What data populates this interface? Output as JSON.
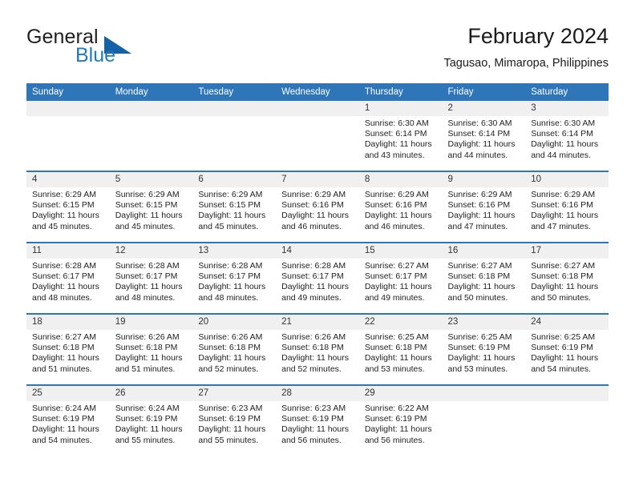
{
  "brand": {
    "word_general": "General",
    "word_blue": "Blue",
    "triangle_color": "#1461a8",
    "blue_color": "#1f7ac0"
  },
  "header": {
    "title": "February 2024",
    "subtitle": "Tagusao, Mimaropa, Philippines"
  },
  "theme": {
    "header_bg": "#2f76b8",
    "header_text": "#ffffff",
    "daynum_bg": "#f0f0f0",
    "cell_bg": "#ffffff",
    "row_border": "#2f76b8"
  },
  "weekday_headers": [
    "Sunday",
    "Monday",
    "Tuesday",
    "Wednesday",
    "Thursday",
    "Friday",
    "Saturday"
  ],
  "weeks": [
    [
      {
        "day": "",
        "sunrise": "",
        "sunset": "",
        "daylight": "",
        "empty": true
      },
      {
        "day": "",
        "sunrise": "",
        "sunset": "",
        "daylight": "",
        "empty": true
      },
      {
        "day": "",
        "sunrise": "",
        "sunset": "",
        "daylight": "",
        "empty": true
      },
      {
        "day": "",
        "sunrise": "",
        "sunset": "",
        "daylight": "",
        "empty": true
      },
      {
        "day": "1",
        "sunrise": "Sunrise: 6:30 AM",
        "sunset": "Sunset: 6:14 PM",
        "daylight": "Daylight: 11 hours and 43 minutes.",
        "empty": false
      },
      {
        "day": "2",
        "sunrise": "Sunrise: 6:30 AM",
        "sunset": "Sunset: 6:14 PM",
        "daylight": "Daylight: 11 hours and 44 minutes.",
        "empty": false
      },
      {
        "day": "3",
        "sunrise": "Sunrise: 6:30 AM",
        "sunset": "Sunset: 6:14 PM",
        "daylight": "Daylight: 11 hours and 44 minutes.",
        "empty": false
      }
    ],
    [
      {
        "day": "4",
        "sunrise": "Sunrise: 6:29 AM",
        "sunset": "Sunset: 6:15 PM",
        "daylight": "Daylight: 11 hours and 45 minutes.",
        "empty": false
      },
      {
        "day": "5",
        "sunrise": "Sunrise: 6:29 AM",
        "sunset": "Sunset: 6:15 PM",
        "daylight": "Daylight: 11 hours and 45 minutes.",
        "empty": false
      },
      {
        "day": "6",
        "sunrise": "Sunrise: 6:29 AM",
        "sunset": "Sunset: 6:15 PM",
        "daylight": "Daylight: 11 hours and 45 minutes.",
        "empty": false
      },
      {
        "day": "7",
        "sunrise": "Sunrise: 6:29 AM",
        "sunset": "Sunset: 6:16 PM",
        "daylight": "Daylight: 11 hours and 46 minutes.",
        "empty": false
      },
      {
        "day": "8",
        "sunrise": "Sunrise: 6:29 AM",
        "sunset": "Sunset: 6:16 PM",
        "daylight": "Daylight: 11 hours and 46 minutes.",
        "empty": false
      },
      {
        "day": "9",
        "sunrise": "Sunrise: 6:29 AM",
        "sunset": "Sunset: 6:16 PM",
        "daylight": "Daylight: 11 hours and 47 minutes.",
        "empty": false
      },
      {
        "day": "10",
        "sunrise": "Sunrise: 6:29 AM",
        "sunset": "Sunset: 6:16 PM",
        "daylight": "Daylight: 11 hours and 47 minutes.",
        "empty": false
      }
    ],
    [
      {
        "day": "11",
        "sunrise": "Sunrise: 6:28 AM",
        "sunset": "Sunset: 6:17 PM",
        "daylight": "Daylight: 11 hours and 48 minutes.",
        "empty": false
      },
      {
        "day": "12",
        "sunrise": "Sunrise: 6:28 AM",
        "sunset": "Sunset: 6:17 PM",
        "daylight": "Daylight: 11 hours and 48 minutes.",
        "empty": false
      },
      {
        "day": "13",
        "sunrise": "Sunrise: 6:28 AM",
        "sunset": "Sunset: 6:17 PM",
        "daylight": "Daylight: 11 hours and 48 minutes.",
        "empty": false
      },
      {
        "day": "14",
        "sunrise": "Sunrise: 6:28 AM",
        "sunset": "Sunset: 6:17 PM",
        "daylight": "Daylight: 11 hours and 49 minutes.",
        "empty": false
      },
      {
        "day": "15",
        "sunrise": "Sunrise: 6:27 AM",
        "sunset": "Sunset: 6:17 PM",
        "daylight": "Daylight: 11 hours and 49 minutes.",
        "empty": false
      },
      {
        "day": "16",
        "sunrise": "Sunrise: 6:27 AM",
        "sunset": "Sunset: 6:18 PM",
        "daylight": "Daylight: 11 hours and 50 minutes.",
        "empty": false
      },
      {
        "day": "17",
        "sunrise": "Sunrise: 6:27 AM",
        "sunset": "Sunset: 6:18 PM",
        "daylight": "Daylight: 11 hours and 50 minutes.",
        "empty": false
      }
    ],
    [
      {
        "day": "18",
        "sunrise": "Sunrise: 6:27 AM",
        "sunset": "Sunset: 6:18 PM",
        "daylight": "Daylight: 11 hours and 51 minutes.",
        "empty": false
      },
      {
        "day": "19",
        "sunrise": "Sunrise: 6:26 AM",
        "sunset": "Sunset: 6:18 PM",
        "daylight": "Daylight: 11 hours and 51 minutes.",
        "empty": false
      },
      {
        "day": "20",
        "sunrise": "Sunrise: 6:26 AM",
        "sunset": "Sunset: 6:18 PM",
        "daylight": "Daylight: 11 hours and 52 minutes.",
        "empty": false
      },
      {
        "day": "21",
        "sunrise": "Sunrise: 6:26 AM",
        "sunset": "Sunset: 6:18 PM",
        "daylight": "Daylight: 11 hours and 52 minutes.",
        "empty": false
      },
      {
        "day": "22",
        "sunrise": "Sunrise: 6:25 AM",
        "sunset": "Sunset: 6:18 PM",
        "daylight": "Daylight: 11 hours and 53 minutes.",
        "empty": false
      },
      {
        "day": "23",
        "sunrise": "Sunrise: 6:25 AM",
        "sunset": "Sunset: 6:19 PM",
        "daylight": "Daylight: 11 hours and 53 minutes.",
        "empty": false
      },
      {
        "day": "24",
        "sunrise": "Sunrise: 6:25 AM",
        "sunset": "Sunset: 6:19 PM",
        "daylight": "Daylight: 11 hours and 54 minutes.",
        "empty": false
      }
    ],
    [
      {
        "day": "25",
        "sunrise": "Sunrise: 6:24 AM",
        "sunset": "Sunset: 6:19 PM",
        "daylight": "Daylight: 11 hours and 54 minutes.",
        "empty": false
      },
      {
        "day": "26",
        "sunrise": "Sunrise: 6:24 AM",
        "sunset": "Sunset: 6:19 PM",
        "daylight": "Daylight: 11 hours and 55 minutes.",
        "empty": false
      },
      {
        "day": "27",
        "sunrise": "Sunrise: 6:23 AM",
        "sunset": "Sunset: 6:19 PM",
        "daylight": "Daylight: 11 hours and 55 minutes.",
        "empty": false
      },
      {
        "day": "28",
        "sunrise": "Sunrise: 6:23 AM",
        "sunset": "Sunset: 6:19 PM",
        "daylight": "Daylight: 11 hours and 56 minutes.",
        "empty": false
      },
      {
        "day": "29",
        "sunrise": "Sunrise: 6:22 AM",
        "sunset": "Sunset: 6:19 PM",
        "daylight": "Daylight: 11 hours and 56 minutes.",
        "empty": false
      },
      {
        "day": "",
        "sunrise": "",
        "sunset": "",
        "daylight": "",
        "empty": true
      },
      {
        "day": "",
        "sunrise": "",
        "sunset": "",
        "daylight": "",
        "empty": true
      }
    ]
  ]
}
